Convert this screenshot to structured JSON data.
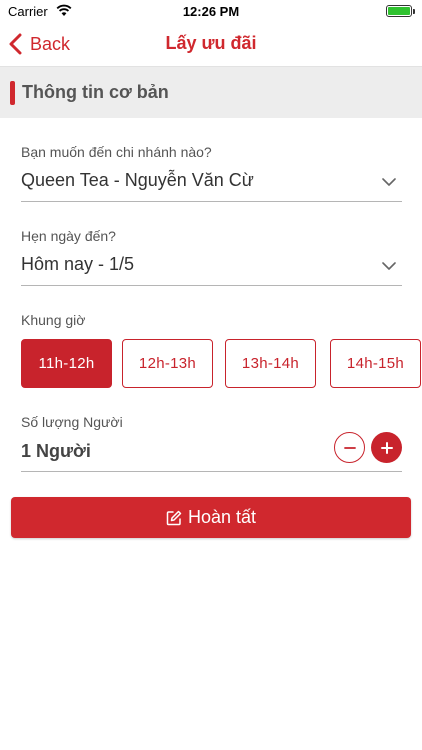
{
  "status_bar": {
    "carrier": "Carrier",
    "time": "12:26 PM"
  },
  "nav": {
    "back_label": "Back",
    "title": "Lấy ưu đãi"
  },
  "section": {
    "title": "Thông tin cơ bản"
  },
  "branch": {
    "label": "Bạn muốn đến chi nhánh nào?",
    "value": "Queen Tea - Nguyễn Văn Cừ"
  },
  "date": {
    "label": "Hẹn ngày đến?",
    "value": "Hôm nay - 1/5"
  },
  "time_slots": {
    "label": "Khung giờ",
    "selected": "11h-12h",
    "options": [
      "11h-12h",
      "12h-13h",
      "13h-14h",
      "14h-15h"
    ]
  },
  "quantity": {
    "label": "Số lượng Người",
    "value": "1 Người"
  },
  "submit": {
    "label": "Hoàn tất"
  },
  "colors": {
    "accent": "#d0282e",
    "section_bg": "#ededed",
    "battery": "#2fc22f"
  },
  "icons": [
    "wifi-icon",
    "battery-icon",
    "chevron-left-icon",
    "chevron-down-icon",
    "minus-icon",
    "plus-icon",
    "edit-icon"
  ]
}
